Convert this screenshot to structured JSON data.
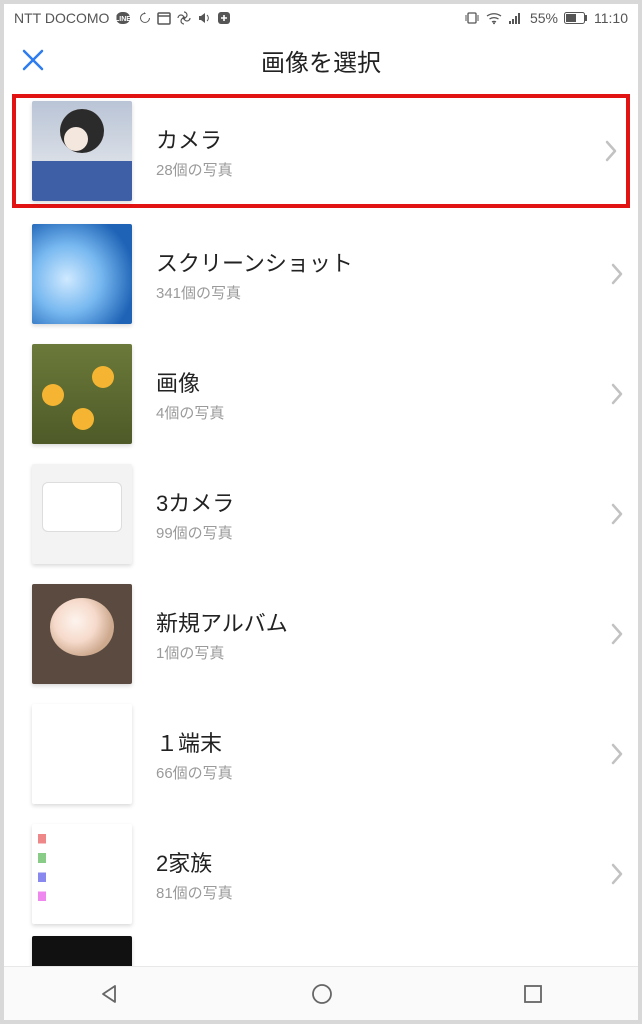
{
  "statusbar": {
    "carrier": "NTT DOCOMO",
    "battery_pct": "55%",
    "time": "11:10"
  },
  "header": {
    "title": "画像を選択"
  },
  "albums": [
    {
      "name": "カメラ",
      "count": "28個の写真"
    },
    {
      "name": "スクリーンショット",
      "count": "341個の写真"
    },
    {
      "name": "画像",
      "count": "4個の写真"
    },
    {
      "name": "3カメラ",
      "count": "99個の写真"
    },
    {
      "name": "新規アルバム",
      "count": "1個の写真"
    },
    {
      "name": "１端末",
      "count": "66個の写真"
    },
    {
      "name": "2家族",
      "count": "81個の写真"
    }
  ]
}
